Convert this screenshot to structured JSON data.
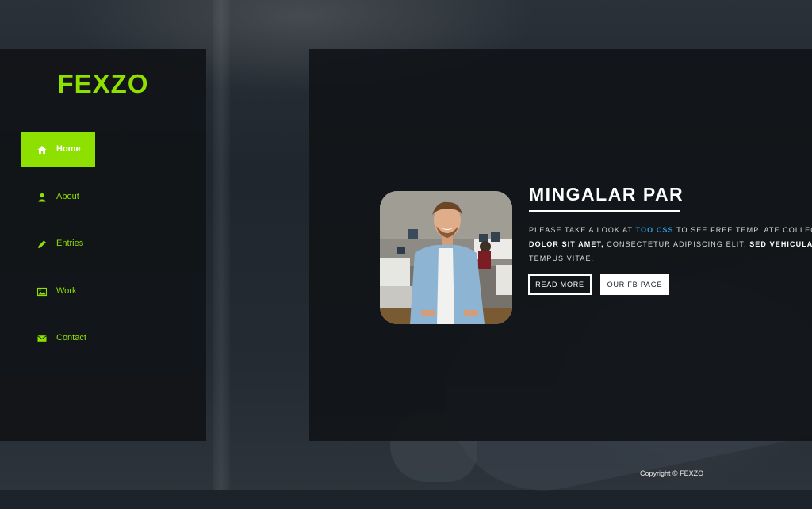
{
  "brand": {
    "logo": "FEXZO",
    "accent_color": "#8ee000"
  },
  "nav": {
    "items": [
      {
        "label": "Home",
        "icon": "home-icon",
        "active": true
      },
      {
        "label": "About",
        "icon": "user-icon",
        "active": false
      },
      {
        "label": "Entries",
        "icon": "pencil-icon",
        "active": false
      },
      {
        "label": "Work",
        "icon": "image-icon",
        "active": false
      },
      {
        "label": "Contact",
        "icon": "envelope-icon",
        "active": false
      }
    ]
  },
  "hero": {
    "heading": "MINGALAR PAR",
    "desc_prefix": "Please take a look at ",
    "desc_link": "Too CSS",
    "desc_mid": " to see free template collectio",
    "desc_bold1": "dolor sit amet,",
    "desc_mid2": " consectetur adipiscing elit. ",
    "desc_bold2": "Sed vehicula bi",
    "desc_end": "tempus vitae.",
    "link_color": "#2f9ae0",
    "read_more_label": "READ MORE",
    "fb_label": "OUR FB PAGE"
  },
  "footer": {
    "copyright": "Copyright © FEXZO"
  }
}
